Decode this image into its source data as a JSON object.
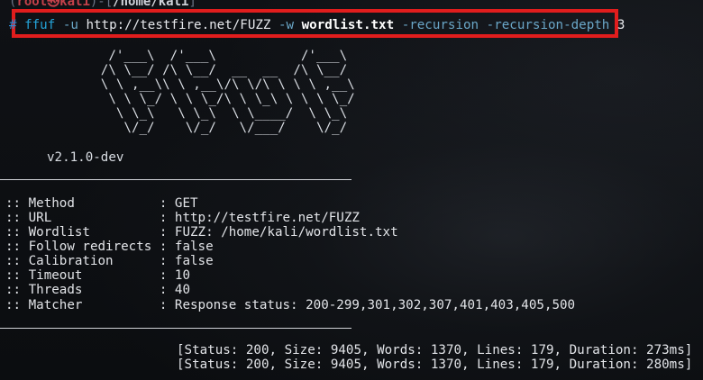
{
  "prompt": {
    "root_label": "root㉿kali",
    "path": "/home/kali"
  },
  "command": {
    "prompt_symbol": "#",
    "binary": "ffuf",
    "flag_u": "-u",
    "url": "http://testfire.net/FUZZ",
    "flag_w": "-w",
    "wordlist": "wordlist.txt",
    "flag_recursion": "-recursion",
    "flag_recursion_depth": "-recursion-depth",
    "depth_value": "3"
  },
  "banner": {
    "ascii_art": "        /'___\\  /'___\\           /'___\\\n       /\\ \\__/ /\\ \\__/  __  __  /\\ \\__/\n       \\ \\ ,__\\\\ \\ ,__\\/\\ \\/\\ \\ \\ \\ ,__\\\n        \\ \\ \\_/ \\ \\ \\_/\\ \\ \\_\\ \\ \\ \\ \\_/\n         \\ \\_\\   \\ \\_\\  \\ \\____/  \\ \\_\\\n          \\/_/    \\/_/   \\/___/    \\/_/",
    "version": "v2.1.0-dev"
  },
  "settings": [
    {
      "label": ":: Method           ",
      "value": ": GET"
    },
    {
      "label": ":: URL              ",
      "value": ": http://testfire.net/FUZZ"
    },
    {
      "label": ":: Wordlist         ",
      "value": ": FUZZ: /home/kali/wordlist.txt"
    },
    {
      "label": ":: Follow redirects ",
      "value": ": false"
    },
    {
      "label": ":: Calibration      ",
      "value": ": false"
    },
    {
      "label": ":: Timeout          ",
      "value": ": 10"
    },
    {
      "label": ":: Threads          ",
      "value": ": 40"
    },
    {
      "label": ":: Matcher          ",
      "value": ": Response status: 200-299,301,302,307,401,403,405,500"
    }
  ],
  "results": [
    "[Status: 200, Size: 9405, Words: 1370, Lines: 179, Duration: 273ms]",
    "[Status: 200, Size: 9405, Words: 1370, Lines: 179, Duration: 280ms]"
  ]
}
